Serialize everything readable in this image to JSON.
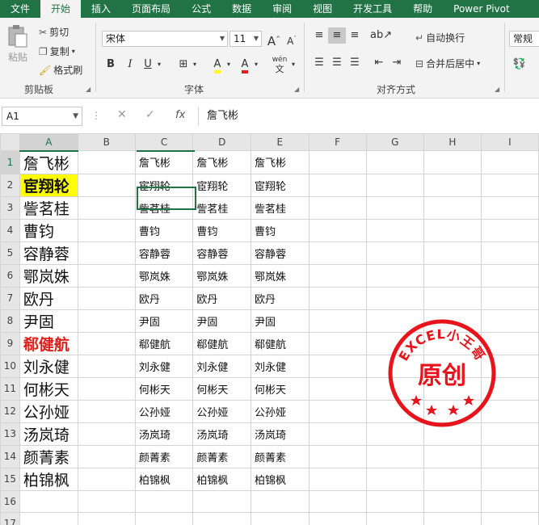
{
  "ribbon_tabs": [
    "文件",
    "开始",
    "插入",
    "页面布局",
    "公式",
    "数据",
    "审阅",
    "视图",
    "开发工具",
    "帮助",
    "Power Pivot"
  ],
  "active_tab": "开始",
  "clipboard": {
    "paste": "粘贴",
    "cut": "剪切",
    "copy": "复制",
    "format_painter": "格式刷",
    "group_label": "剪贴板"
  },
  "font": {
    "name": "宋体",
    "size": "11",
    "bold": "B",
    "italic": "I",
    "underline": "U",
    "grow": "A",
    "shrink": "A",
    "fill_letter": "A",
    "color_letter": "A",
    "phonetic": "wén",
    "group_label": "字体"
  },
  "alignment": {
    "wrap": "自动换行",
    "merge": "合并后居中",
    "group_label": "对齐方式"
  },
  "number": {
    "format": "常规"
  },
  "formula_bar": {
    "name_box": "A1",
    "dots": "⋮",
    "cancel": "✕",
    "enter": "✓",
    "fx": "fx",
    "value": "詹飞彬"
  },
  "columns": [
    "A",
    "B",
    "C",
    "D",
    "E",
    "F",
    "G",
    "H",
    "I"
  ],
  "row_numbers": [
    "1",
    "2",
    "3",
    "4",
    "5",
    "6",
    "7",
    "8",
    "9",
    "10",
    "11",
    "12",
    "13",
    "14",
    "15",
    "16",
    "17"
  ],
  "col_a": [
    "詹飞彬",
    "宦翔轮",
    "訾茗桂",
    "曹钧",
    "容静蓉",
    "鄂岚姝",
    "欧丹",
    "尹固",
    "郗健航",
    "刘永健",
    "何彬天",
    "公孙娅",
    "汤岚琦",
    "颜菁素",
    "柏锦枫"
  ],
  "col_c": [
    "詹飞彬",
    "宦翔轮",
    "訾茗桂",
    "曹钧",
    "容静蓉",
    "鄂岚姝",
    "欧丹",
    "尹固",
    "郗健航",
    "刘永健",
    "何彬天",
    "公孙娅",
    "汤岚琦",
    "颜菁素",
    "柏锦枫"
  ],
  "col_d": [
    "詹飞彬",
    "宦翔轮",
    "訾茗桂",
    "曹钧",
    "容静蓉",
    "鄂岚姝",
    "欧丹",
    "尹固",
    "郗健航",
    "刘永健",
    "何彬天",
    "公孙娅",
    "汤岚琦",
    "颜菁素",
    "柏锦枫"
  ],
  "col_e": [
    "詹飞彬",
    "宦翔轮",
    "訾茗桂",
    "曹钧",
    "容静蓉",
    "鄂岚姝",
    "欧丹",
    "尹固",
    "郗健航",
    "刘永健",
    "何彬天",
    "公孙娅",
    "汤岚琦",
    "颜菁素",
    "柏锦枫"
  ],
  "stamp": {
    "arc_text": "EXCEL小王哥",
    "center_text": "原创"
  },
  "colors": {
    "brand": "#217346",
    "highlight": "#ffff00",
    "red_text": "#e0201a",
    "stamp_red": "#e8141c"
  },
  "icons": [
    "cut-icon",
    "copy-icon",
    "format-painter-icon",
    "paste-icon",
    "border-icon",
    "fill-color-icon",
    "font-color-icon",
    "orientation-icon",
    "wrap-icon",
    "merge-icon",
    "align-icons",
    "fx-icon"
  ]
}
